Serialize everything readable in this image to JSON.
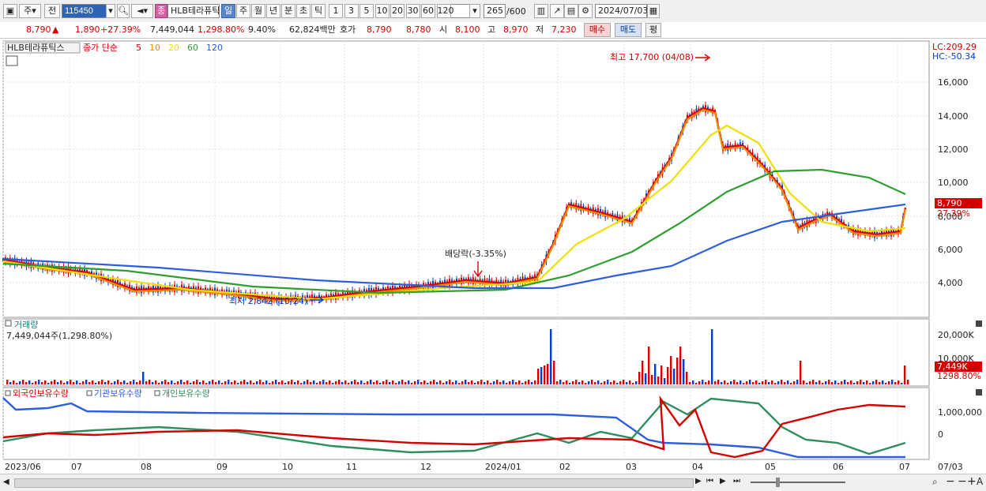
{
  "toolbar": {
    "market": "주",
    "prev_label": "전",
    "code": "115450",
    "stock_name": "HLB테라퓨틱",
    "stock_badge": "종",
    "periods": [
      "일",
      "주",
      "월",
      "년",
      "분",
      "초",
      "틱"
    ],
    "active_period": "일",
    "intervals": [
      "1",
      "3",
      "5",
      "10",
      "20",
      "30",
      "60",
      "120"
    ],
    "count": "265",
    "count_max": "/600",
    "date": "2024/07/03"
  },
  "quote": {
    "price": "8,790",
    "arrow": "▲",
    "change": "1,890",
    "change_pct": "+27.39%",
    "volume": "7,449,044",
    "volume_pct": "1,298.80%",
    "turnover": "9.40%",
    "amount": "62,824백만",
    "ask_label": "호가",
    "ask": "8,790",
    "bid": "8,780",
    "open_label": "시",
    "open": "8,100",
    "high_label": "고",
    "high": "8,970",
    "low_label": "저",
    "low": "7,230",
    "buy_button": "매수",
    "sell_button": "매도",
    "eval_button": "평"
  },
  "price_panel": {
    "name_tag": "HLB테라퓨틱스",
    "ma_label": "종가 단순",
    "ma_periods": [
      "5",
      "10",
      "20",
      "60",
      "120"
    ],
    "ma_colors": [
      "#d40000",
      "#f08c00",
      "#f0e000",
      "#2e9e2e",
      "#2e5ee0"
    ],
    "lc": "LC:209.29",
    "hc": "HC:-50.34",
    "price_ticks": [
      "16,000",
      "14,000",
      "12,000",
      "10,000",
      "8,000",
      "6,000",
      "4,000"
    ],
    "high_annotation": "최고 17,700 (04/08)",
    "low_annotation": "최저 2,842 (10/24)",
    "dividend_annotation": "배당락(-3.35%)",
    "current_price_tag": "8,790",
    "current_pct_tag": "27.39%"
  },
  "volume_panel": {
    "title": "거래량",
    "value": "7,449,044주(1,298.80%)",
    "ticks": [
      "20,000K",
      "10,000K"
    ],
    "current_tag": "7,449K",
    "current_pct_tag": "1298.80%"
  },
  "holding_panel": {
    "legend": [
      "외국인보유수량",
      "기관보유수량",
      "개인보유수량"
    ],
    "legend_colors": [
      "#d40000",
      "#2e5ee0",
      "#2e8e5e"
    ],
    "ticks": [
      "1,000,000",
      "0"
    ]
  },
  "x_axis": [
    "2023/06",
    "07",
    "08",
    "09",
    "10",
    "11",
    "12",
    "2024/01",
    "02",
    "03",
    "04",
    "05",
    "06",
    "07",
    "07/03"
  ],
  "colors": {
    "up": "#d40000",
    "down": "#0040c8",
    "accent": "#5a86c6"
  }
}
